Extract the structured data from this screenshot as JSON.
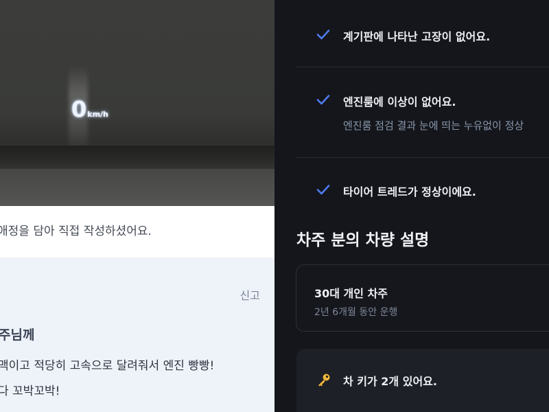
{
  "left": {
    "hud_speed": {
      "value": "0",
      "unit": "km/h"
    },
    "review_caption": "애정을 담아 직접 작성하셨어요.",
    "review": {
      "report_label": "신고",
      "recipient": "주님께",
      "message_line1": "맥이고 적당히 고속으로 달려줘서 엔진 빵빵!",
      "message_line2": "다 꼬박꼬박!"
    }
  },
  "right": {
    "checks": [
      {
        "label": "계기판에 나타난 고장이 없어요.",
        "icon": "check-icon"
      },
      {
        "label": "엔진룸에 이상이 없어요.",
        "description": "엔진룸 점검 결과 눈에 띄는 누유없이 정상",
        "icon": "check-icon"
      },
      {
        "label": "타이어 트레드가 정상이에요.",
        "icon": "check-icon"
      }
    ],
    "section_title": "차주 분의 차량 설명",
    "owner": {
      "title": "30대 개인 차주",
      "subtitle": "2년 6개월 동안 운행"
    },
    "key_note": {
      "label": "차 키가 2개 있어요.",
      "icon": "key-icon"
    },
    "colors": {
      "check": "#4f7cf0",
      "key": "#f0b63a",
      "background": "#14161b"
    }
  }
}
